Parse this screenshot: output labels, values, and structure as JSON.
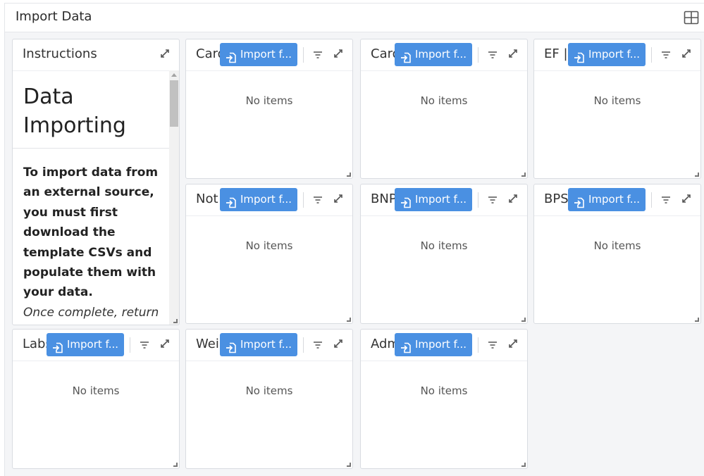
{
  "header": {
    "title": "Import Data",
    "layout_icon": "grid-layout-icon"
  },
  "instructions": {
    "title": "Instructions",
    "heading_line1": "Data",
    "heading_line2": "Importing",
    "bold_text": "To import data from an external source, you must first download the template CSVs and populate them with your data.",
    "italic_text": "Once complete, return"
  },
  "panels": [
    {
      "title": "Card",
      "import_label": "Import f...",
      "empty": "No items"
    },
    {
      "title": "Card",
      "import_label": "Import f...",
      "empty": "No items"
    },
    {
      "title": "EF |",
      "import_label": "Import f...",
      "empty": "No items"
    },
    {
      "title": "Not",
      "import_label": "Import f...",
      "empty": "No items"
    },
    {
      "title": "BNP",
      "import_label": "Import f...",
      "empty": "No items"
    },
    {
      "title": "BPS",
      "import_label": "Import f...",
      "empty": "No items"
    },
    {
      "title": "Labs",
      "import_label": "Import f...",
      "empty": "No items"
    },
    {
      "title": "Wei",
      "import_label": "Import f...",
      "empty": "No items"
    },
    {
      "title": "Adm",
      "import_label": "Import f...",
      "empty": "No items"
    }
  ],
  "colors": {
    "button": "#4a90e2",
    "background": "#f4f5f7",
    "border": "#d9dce1"
  }
}
